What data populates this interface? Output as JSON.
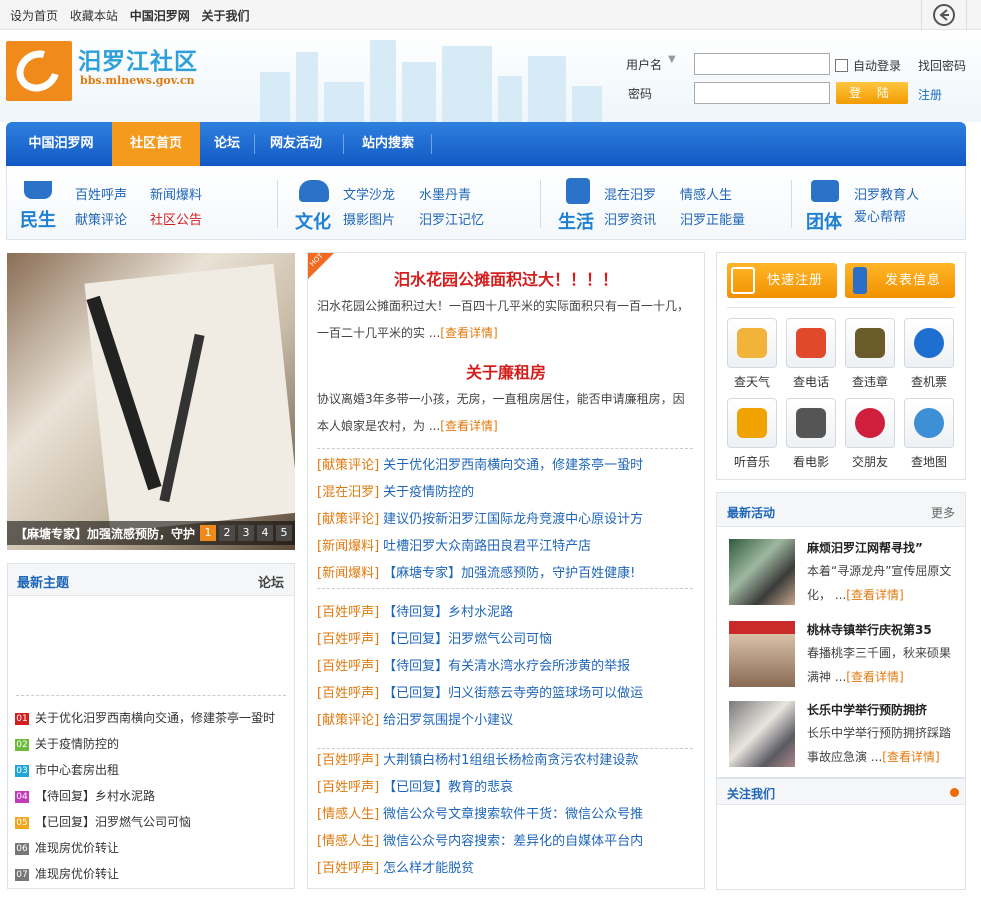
{
  "topbar": {
    "links": [
      "设为首页",
      "收藏本站",
      "中国汨罗网",
      "关于我们"
    ]
  },
  "logo": {
    "title": "汨罗江社区",
    "url": "bbs.mlnews.gov.cn"
  },
  "login": {
    "username_label": "用户名",
    "password_label": "密码",
    "auto_login": "自动登录",
    "forgot": "找回密码",
    "login_button": "登 陆",
    "register": "注册"
  },
  "nav": [
    "中国汨罗网",
    "社区首页",
    "论坛",
    "网友活动",
    "站内搜索"
  ],
  "categories": [
    {
      "name": "民生",
      "links": [
        "百姓呼声",
        "新闻爆料",
        "献策评论",
        "社区公告"
      ]
    },
    {
      "name": "文化",
      "links": [
        "文学沙龙",
        "水墨丹青",
        "摄影图片",
        "汨罗江记忆"
      ]
    },
    {
      "name": "生活",
      "links": [
        "混在汨罗",
        "情感人生",
        "汨罗资讯",
        "汨罗正能量"
      ]
    },
    {
      "name": "团体",
      "links": [
        "汨罗教育人",
        "爱心帮帮"
      ]
    }
  ],
  "slider": {
    "caption": "【麻塘专家】加强流感预防，守护百姓健康!",
    "dots": [
      "1",
      "2",
      "3",
      "4",
      "5"
    ]
  },
  "latest": {
    "title": "最新主题",
    "right": "论坛",
    "items": [
      {
        "num": "01",
        "color": "#d41e1e",
        "text": "关于优化汨罗西南横向交通，修建茶亭一蛩时"
      },
      {
        "num": "02",
        "color": "#6cbb3c",
        "text": "关于疫情防控的"
      },
      {
        "num": "03",
        "color": "#1da7d9",
        "text": "市中心套房出租"
      },
      {
        "num": "04",
        "color": "#c23bb8",
        "text": "【待回复】乡村水泥路"
      },
      {
        "num": "05",
        "color": "#f2a51a",
        "text": "【已回复】汨罗燃气公司可恼"
      },
      {
        "num": "06",
        "color": "#777777",
        "text": "准现房优价转让"
      },
      {
        "num": "07",
        "color": "#777777",
        "text": "准现房优价转让"
      }
    ]
  },
  "middle": {
    "hot": "HOT",
    "more": "[查看详情]",
    "headline1": "汨水花园公摊面积过大！！！！",
    "summary1": "汨水花园公摊面积过大！一百四十几平米的实际面积只有一百一十几，一百二十几平米的实 ...",
    "headline2": "关于廉租房",
    "summary2": "协议离婚3年多带一小孩，无房，一直租房居住，能否申请廉租房，因本人娘家是农村，为 ...",
    "group1": [
      {
        "tag": "[献策评论]",
        "text": "关于优化汨罗西南横向交通，修建茶亭一蛩时"
      },
      {
        "tag": "[混在汨罗]",
        "text": "关于疫情防控的"
      },
      {
        "tag": "[献策评论]",
        "text": "建议仍按新汨罗江国际龙舟竞渡中心原设计方"
      },
      {
        "tag": "[新闻爆料]",
        "text": "吐槽汨罗大众南路田良君平江特产店"
      },
      {
        "tag": "[新闻爆料]",
        "text": "【麻塘专家】加强流感预防，守护百姓健康!"
      }
    ],
    "group2": [
      {
        "tag": "[百姓呼声]",
        "text": "【待回复】乡村水泥路"
      },
      {
        "tag": "[百姓呼声]",
        "text": "【已回复】汨罗燃气公司可恼"
      },
      {
        "tag": "[百姓呼声]",
        "text": "【待回复】有关清水湾水疗会所涉黄的举报"
      },
      {
        "tag": "[百姓呼声]",
        "text": "【已回复】归义街慈云寺旁的篮球场可以做运"
      },
      {
        "tag": "[献策评论]",
        "text": "给汨罗氛围提个小建议"
      }
    ],
    "group3": [
      {
        "tag": "[百姓呼声]",
        "text": "大荆镇白杨村1组组长杨检南贪污农村建设款"
      },
      {
        "tag": "[百姓呼声]",
        "text": "【已回复】教育的悲哀"
      },
      {
        "tag": "[情感人生]",
        "text": "微信公众号文章搜索软件干货：微信公众号推"
      },
      {
        "tag": "[情感人生]",
        "text": "微信公众号内容搜索：差异化的自媒体平台内"
      },
      {
        "tag": "[百姓呼声]",
        "text": "怎么样才能脱贫"
      }
    ]
  },
  "tools": {
    "quick_register": "快速注册",
    "post_info": "发表信息",
    "items": [
      {
        "label": "查天气",
        "icon": "weather-icon",
        "color": "#f2b33a"
      },
      {
        "label": "查电话",
        "icon": "phone-icon",
        "color": "#e0492b"
      },
      {
        "label": "查违章",
        "icon": "traffic-light-icon",
        "color": "#6b5a2a"
      },
      {
        "label": "查机票",
        "icon": "airplane-icon",
        "color": "#1f6fd0"
      },
      {
        "label": "听音乐",
        "icon": "music-icon",
        "color": "#f0a300"
      },
      {
        "label": "看电影",
        "icon": "clapperboard-icon",
        "color": "#555555"
      },
      {
        "label": "交朋友",
        "icon": "heart-icon",
        "color": "#d01f3c"
      },
      {
        "label": "查地图",
        "icon": "globe-icon",
        "color": "#3d8fd6"
      }
    ]
  },
  "activity": {
    "title": "最新活动",
    "more_label": "更多",
    "more": "[查看详情]",
    "items": [
      {
        "title": "麻烦汨罗江网帮寻找”",
        "text": "本着“寻源龙舟”宣传屈原文化， ..."
      },
      {
        "title": "桃林寺镇举行庆祝第35",
        "text": "春播桃李三千圃，秋来硕果满神 ..."
      },
      {
        "title": "长乐中学举行预防拥挤",
        "text": "长乐中学举行预防拥挤踩踏事故应急演 ..."
      }
    ]
  },
  "follow": {
    "title": "关注我们"
  },
  "colors": {
    "nav_blue": "#1f6fd4",
    "accent_orange": "#f59a1d",
    "link_blue": "#1f66b8",
    "tag_orange": "#e07a10",
    "headline_red": "#d41e1e"
  }
}
